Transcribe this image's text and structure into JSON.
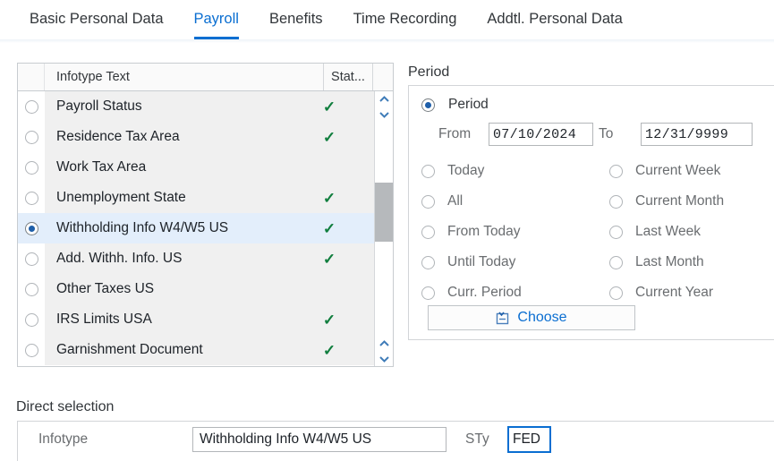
{
  "tabs": [
    {
      "label": "Basic Personal Data",
      "active": false
    },
    {
      "label": "Payroll",
      "active": true
    },
    {
      "label": "Benefits",
      "active": false
    },
    {
      "label": "Time Recording",
      "active": false
    },
    {
      "label": "Addtl. Personal Data",
      "active": false
    }
  ],
  "infotype_list": {
    "columns": {
      "radio": "",
      "text": "Infotype Text",
      "status": "Stat..."
    },
    "rows": [
      {
        "label": "Payroll Status",
        "status": "check",
        "selected": false
      },
      {
        "label": "Residence Tax Area",
        "status": "check",
        "selected": false
      },
      {
        "label": "Work Tax Area",
        "status": "",
        "selected": false
      },
      {
        "label": "Unemployment State",
        "status": "check",
        "selected": false
      },
      {
        "label": "Withholding Info W4/W5 US",
        "status": "check",
        "selected": true
      },
      {
        "label": "Add. Withh. Info.  US",
        "status": "check",
        "selected": false
      },
      {
        "label": "Other Taxes  US",
        "status": "",
        "selected": false
      },
      {
        "label": "IRS Limits USA",
        "status": "check",
        "selected": false
      },
      {
        "label": "Garnishment Document",
        "status": "check",
        "selected": false
      }
    ],
    "status_glyph": "✓",
    "scrollbar": {
      "up_icon": "⌃",
      "down_icon": "⌄"
    }
  },
  "period": {
    "group_label": "Period",
    "period_option_label": "Period",
    "period_option_selected": true,
    "from_label": "From",
    "from_value": "07/10/2024",
    "to_label": "To",
    "to_value": "12/31/9999",
    "options": [
      {
        "label": "Today",
        "selected": false
      },
      {
        "label": "Current Week",
        "selected": false
      },
      {
        "label": "All",
        "selected": false
      },
      {
        "label": "Current Month",
        "selected": false
      },
      {
        "label": "From Today",
        "selected": false
      },
      {
        "label": "Last Week",
        "selected": false
      },
      {
        "label": "Until Today",
        "selected": false
      },
      {
        "label": "Last Month",
        "selected": false
      },
      {
        "label": "Curr. Period",
        "selected": false
      },
      {
        "label": "Current Year",
        "selected": false
      }
    ],
    "choose_button": {
      "label": "Choose",
      "icon": "calendar-pick-icon"
    }
  },
  "direct_selection": {
    "group_label": "Direct selection",
    "infotype_label": "Infotype",
    "infotype_value": "Withholding Info W4/W5 US",
    "sty_label": "STy",
    "sty_value": "FED"
  },
  "colors": {
    "accent": "#0a6ed1",
    "check_green": "#107e3e",
    "row_bg": "#f0f0f0",
    "row_selected_bg": "#e3eefb",
    "label_gray": "#6a6d70",
    "focus_blue": "#0a6ed1"
  }
}
